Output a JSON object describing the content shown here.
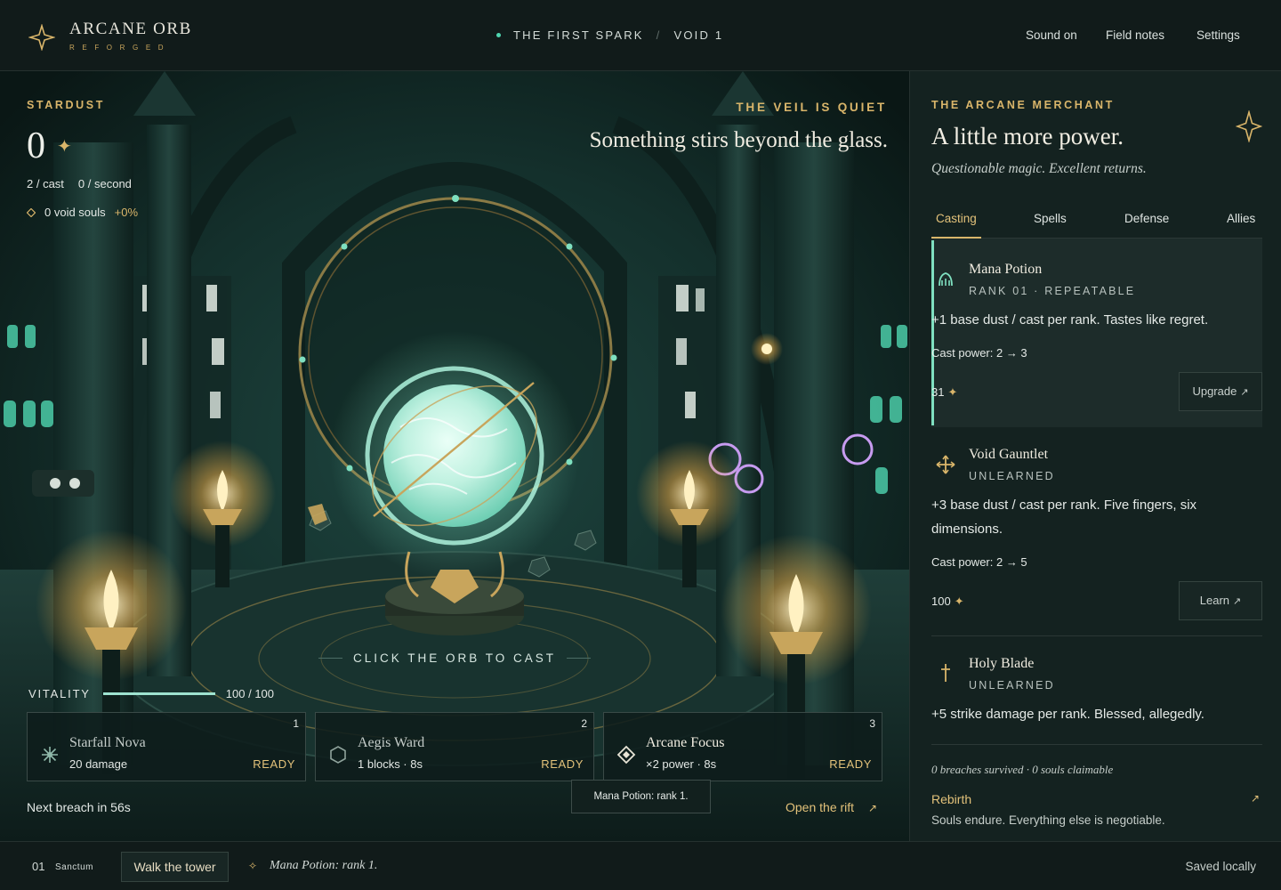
{
  "brand": {
    "title": "ARCANE ORB",
    "subtitle": "REFORGED"
  },
  "breadcrumb": {
    "area": "THE FIRST SPARK",
    "level": "VOID 1"
  },
  "nav": {
    "sound": "Sound on",
    "notes": "Field notes",
    "settings": "Settings"
  },
  "hud": {
    "stardust_label": "STARDUST",
    "stardust_value": "0",
    "per_cast": "2 / cast",
    "per_second": "0 / second",
    "souls": "0 void souls",
    "souls_bonus": "+0%",
    "veil_label": "THE VEIL IS QUIET",
    "veil_text": "Something stirs beyond the glass.",
    "cast_hint": "CLICK THE ORB TO CAST",
    "vitality_label": "VITALITY",
    "vitality_text": "100 / 100",
    "vitality_fraction": 1.0
  },
  "spells": [
    {
      "slot": "1",
      "name": "Starfall Nova",
      "stat": "20 damage",
      "status": "READY",
      "icon": "starburst-icon"
    },
    {
      "slot": "2",
      "name": "Aegis Ward",
      "stat": "1 blocks · 8s",
      "status": "READY",
      "icon": "hexagon-shield-icon"
    },
    {
      "slot": "3",
      "name": "Arcane Focus",
      "stat": "×2 power · 8s",
      "status": "READY",
      "icon": "diamond-focus-icon"
    }
  ],
  "tooltip": "Mana Potion: rank 1.",
  "breach": "Next breach in 56s",
  "rift": "Open the rift",
  "shop": {
    "label": "THE ARCANE MERCHANT",
    "title": "A little more power.",
    "subtitle": "Questionable magic. Excellent returns.",
    "tabs": [
      "Casting",
      "Spells",
      "Defense",
      "Allies"
    ],
    "items": [
      {
        "name": "Mana Potion",
        "rank": "RANK 01 · REPEATABLE",
        "desc": "+1 base dust / cast per rank. Tastes like regret.",
        "power": "Cast power: 2 → 3",
        "cost": "31",
        "button": "Upgrade",
        "icon": "potion-icon"
      },
      {
        "name": "Void Gauntlet",
        "rank": "UNLEARNED",
        "desc": "+3 base dust / cast per rank. Five fingers, six dimensions.",
        "power": "Cast power: 2 → 5",
        "cost": "100",
        "button": "Learn",
        "icon": "gauntlet-icon"
      },
      {
        "name": "Holy Blade",
        "rank": "UNLEARNED",
        "desc": "+5 strike damage per rank. Blessed, allegedly.",
        "icon": "dagger-icon"
      }
    ],
    "prestige": "0 breaches survived · 0 souls claimable",
    "rebirth": "Rebirth",
    "rebirth_sub": "Souls endure. Everything else is negotiable."
  },
  "footer": {
    "loc_num": "01",
    "loc_name": "Sanctum",
    "walk": "Walk the tower",
    "log": "Mana Potion: rank 1.",
    "saved": "Saved locally"
  },
  "colors": {
    "gold": "#d9b56a",
    "teal": "#7fe0c0",
    "bg": "#101a19"
  }
}
